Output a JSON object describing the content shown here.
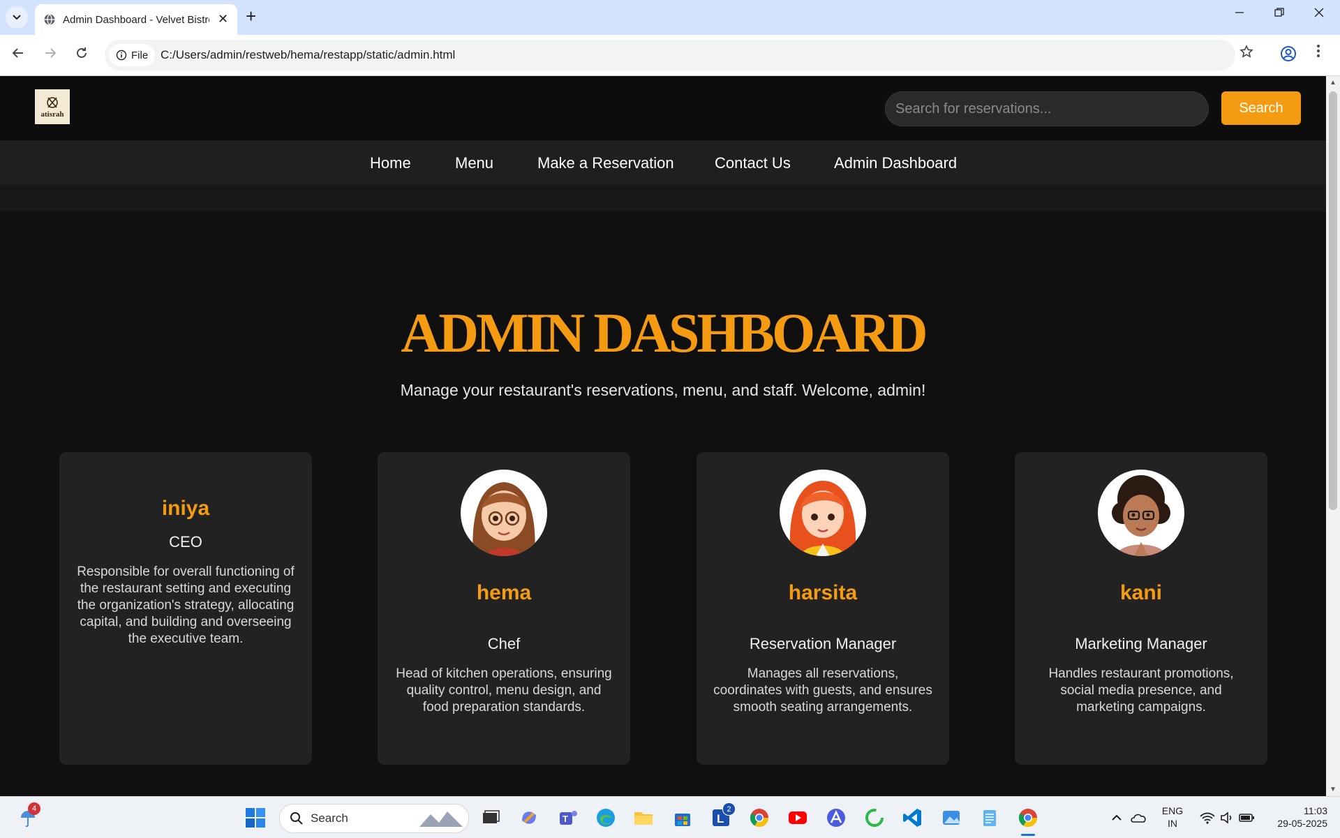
{
  "browser": {
    "tab_title": "Admin Dashboard - Velvet Bistro",
    "tab_close": "✕",
    "new_tab": "+",
    "file_chip": "File",
    "url": "C:/Users/admin/restweb/hema/restapp/static/admin.html"
  },
  "site": {
    "logo_text": "atisrah",
    "search_placeholder": "Search for reservations...",
    "search_button": "Search",
    "nav": [
      "Home",
      "Menu",
      "Make a Reservation",
      "Contact Us",
      "Admin Dashboard"
    ]
  },
  "hero": {
    "title": "ADMIN DASHBOARD",
    "subtitle": "Manage your restaurant's reservations, menu, and staff. Welcome, admin!"
  },
  "staff": [
    {
      "name": "iniya",
      "role": "CEO",
      "description": "Responsible for overall functioning of the restaurant setting and executing the organization's strategy, allocating capital, and building and overseeing the executive team.",
      "has_avatar": false
    },
    {
      "name": "hema",
      "role": "Chef",
      "description": "Head of kitchen operations, ensuring quality control, menu design, and food preparation standards.",
      "has_avatar": true
    },
    {
      "name": "harsita",
      "role": "Reservation Manager",
      "description": "Manages all reservations, coordinates with guests, and ensures smooth seating arrangements.",
      "has_avatar": true
    },
    {
      "name": "kani",
      "role": "Marketing Manager",
      "description": "Handles restaurant promotions, social media presence, and marketing campaigns.",
      "has_avatar": true
    }
  ],
  "taskbar": {
    "search_label": "Search",
    "notification_count": "4",
    "outlook_badge": "2",
    "lang_top": "ENG",
    "lang_bottom": "IN",
    "time": "11:03",
    "date": "29-05-2025"
  },
  "colors": {
    "accent": "#f49b12",
    "page_bg": "#101010",
    "card_bg": "#222222",
    "nav_bg": "#1f1f1f"
  }
}
